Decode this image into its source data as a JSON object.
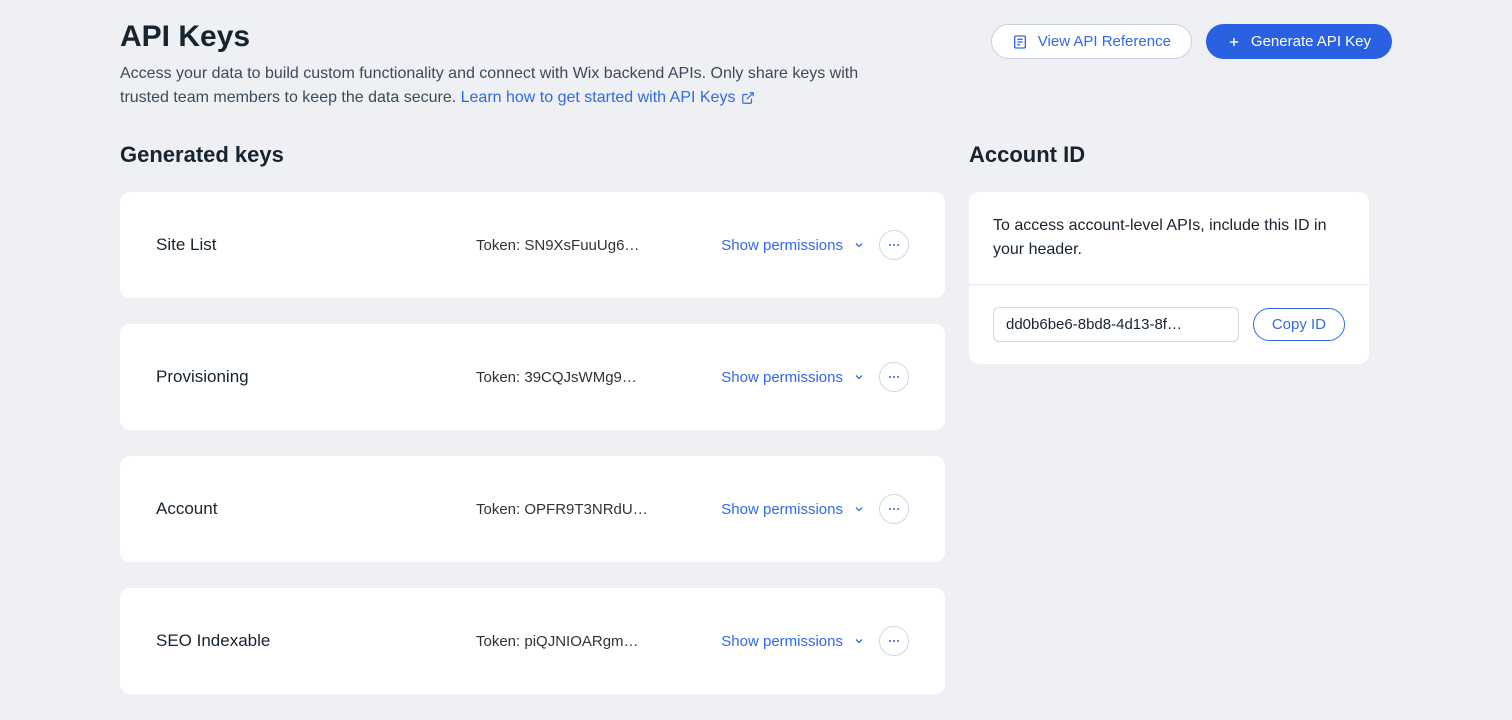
{
  "page": {
    "title": "API Keys",
    "subtitle": "Access your data to build custom functionality and connect with Wix backend APIs. Only share keys with trusted team members to keep the data secure. ",
    "learn_link": "Learn how to get started with API Keys"
  },
  "actions": {
    "view_ref": "View API Reference",
    "generate": "Generate API Key"
  },
  "sections": {
    "generated_keys": "Generated keys",
    "account_id": "Account ID"
  },
  "keys": [
    {
      "name": "Site List",
      "token_label": "Token: SN9XsFuuUg6…",
      "show_perms": "Show permissions"
    },
    {
      "name": "Provisioning",
      "token_label": "Token: 39CQJsWMg9…",
      "show_perms": "Show permissions"
    },
    {
      "name": "Account",
      "token_label": "Token: OPFR9T3NRdU…",
      "show_perms": "Show permissions"
    },
    {
      "name": "SEO Indexable",
      "token_label": "Token: piQJNIOARgm…",
      "show_perms": "Show permissions"
    }
  ],
  "account": {
    "description": "To access account-level APIs, include this ID in your header.",
    "id_display": "dd0b6be6-8bd8-4d13-8f…",
    "copy_label": "Copy ID"
  }
}
